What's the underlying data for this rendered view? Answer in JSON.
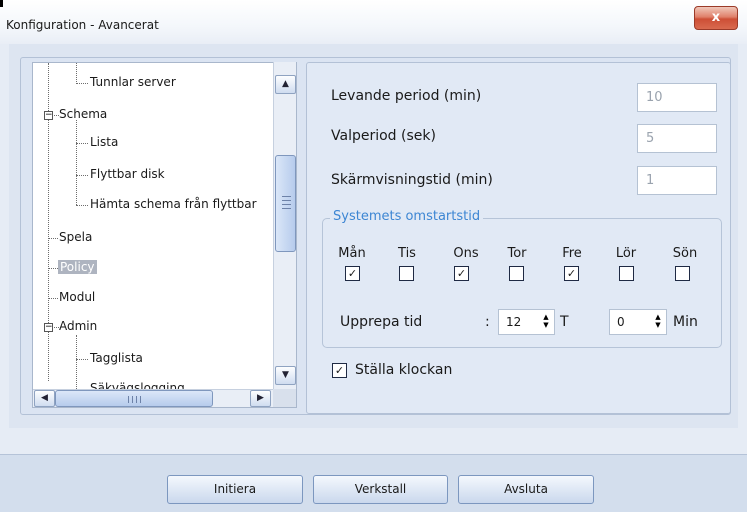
{
  "window": {
    "title": "Konfiguration - Avancerat",
    "close_label": "x"
  },
  "tree": {
    "items": [
      {
        "label": "Tunnlar server"
      },
      {
        "label": "Schema",
        "expander": "−"
      },
      {
        "label": "Lista"
      },
      {
        "label": "Flyttbar disk"
      },
      {
        "label": "Hämta schema från flyttbar"
      },
      {
        "label": "Spela"
      },
      {
        "label": "Policy",
        "selected": true
      },
      {
        "label": "Modul"
      },
      {
        "label": "Admin",
        "expander": "−"
      },
      {
        "label": "Tagglista"
      },
      {
        "label": "Säkvägslogging"
      }
    ]
  },
  "fields": {
    "live_period_label": "Levande period (min)",
    "live_period_value": "10",
    "poll_period_label": "Valperiod (sek)",
    "poll_period_value": "5",
    "screen_time_label": "Skärmvisningstid (min)",
    "screen_time_value": "1"
  },
  "restart": {
    "title": "Systemets omstartstid",
    "days": [
      {
        "label": "Mån",
        "checked": true
      },
      {
        "label": "Tis",
        "checked": false
      },
      {
        "label": "Ons",
        "checked": true
      },
      {
        "label": "Tor",
        "checked": false
      },
      {
        "label": "Fre",
        "checked": true
      },
      {
        "label": "Lör",
        "checked": false
      },
      {
        "label": "Sön",
        "checked": false
      }
    ],
    "repeat_label": "Upprepa tid",
    "colon": ":",
    "hour_value": "12",
    "hour_unit": "T",
    "minute_value": "0",
    "minute_unit": "Min"
  },
  "set_clock": {
    "label": "Ställa klockan",
    "checked": true
  },
  "buttons": {
    "init": "Initiera",
    "apply": "Verkstall",
    "exit": "Avsluta"
  },
  "check_mark": "✓"
}
